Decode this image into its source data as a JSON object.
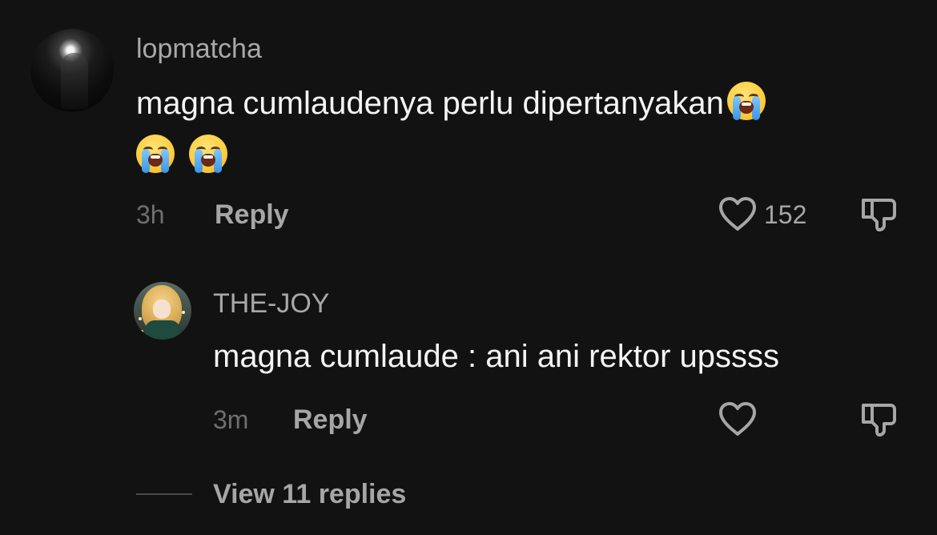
{
  "comment": {
    "username": "lopmatcha",
    "text": "magna cumlaudenya perlu dipertanyakan",
    "emoji_icon": "loudly-crying-face-emoji",
    "time": "3h",
    "reply_label": "Reply",
    "likes": "152"
  },
  "reply": {
    "username": "THE-JOY",
    "text": "magna cumlaude : ani ani rektor upssss",
    "time": "3m",
    "reply_label": "Reply"
  },
  "view_replies_label": "View 11 replies",
  "icons": {
    "like": "heart-outline-icon",
    "dislike": "thumbs-down-outline-icon"
  },
  "colors": {
    "background": "#121212",
    "username": "#a8a8a8",
    "text": "#f4f4f4",
    "secondary": "#a6a6a6",
    "timestamp": "#6f6f6f"
  }
}
